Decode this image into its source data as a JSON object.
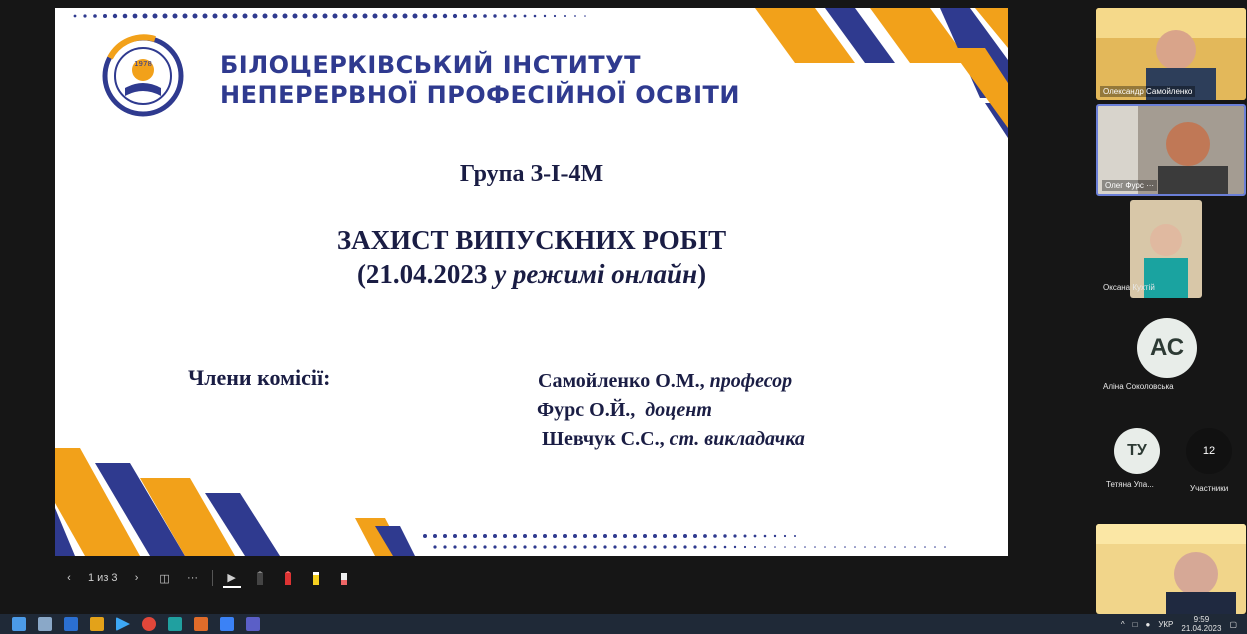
{
  "slide": {
    "institute_line1": "БІЛОЦЕРКІВСЬКИЙ ІНСТИТУТ",
    "institute_line2": "НЕПЕРЕРВНОЇ ПРОФЕСІЙНОЇ ОСВІТИ",
    "logo_year": "1978",
    "group": "Група З-І-4М",
    "defense_title": "ЗАХИСТ ВИПУСКНИХ РОБІТ",
    "defense_date_prefix": "(21.04.2023 ",
    "defense_mode": "у режимі онлайн",
    "defense_date_suffix": ")",
    "committee_label": "Члени комісії:",
    "members": [
      {
        "name": "Самойленко О.М.,",
        "role": "професор"
      },
      {
        "name": "Фурс О.Й.,",
        "role": "доцент"
      },
      {
        "name": "Шевчук С.С.,",
        "role": "ст. викладачка"
      }
    ],
    "colors": {
      "navy": "#2f3a8f",
      "orange": "#f2a11a",
      "text": "#1a1d44"
    }
  },
  "toolbar": {
    "page_indicator": "1 из 3",
    "more": "···"
  },
  "participants": [
    {
      "name": "Олександр Самойленко"
    },
    {
      "name": "Олег Фурс"
    },
    {
      "name": "Оксана Кухтій"
    },
    {
      "name": "Аліна Соколовська",
      "initials": "АС"
    },
    {
      "name": "Тетяна Упа...",
      "initials": "ТУ"
    },
    {
      "name": "Участники",
      "count": "12"
    }
  ],
  "taskbar": {
    "language": "УКР",
    "time": "9:59",
    "date": "21.04.2023"
  }
}
